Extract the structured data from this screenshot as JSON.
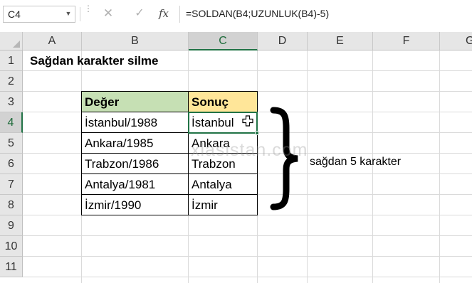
{
  "formula_bar": {
    "name_box": "C4",
    "cancel_icon": "✕",
    "enter_icon": "✓",
    "fx_label": "fx",
    "formula": "=SOLDAN(B4;UZUNLUK(B4)-5)"
  },
  "columns": [
    "A",
    "B",
    "C",
    "D",
    "E",
    "F",
    "G"
  ],
  "rows": [
    "1",
    "2",
    "3",
    "4",
    "5",
    "6",
    "7",
    "8",
    "9",
    "10",
    "11"
  ],
  "sheet": {
    "title": "Sağdan karakter silme",
    "header_deger": "Değer",
    "header_sonuc": "Sonuç",
    "values": [
      "İstanbul/1988",
      "Ankara/1985",
      "Trabzon/1986",
      "Antalya/1981",
      "İzmir/1990"
    ],
    "results": [
      "İstanbul",
      "Ankara",
      "Trabzon",
      "Antalya",
      "İzmir"
    ],
    "note": "sağdan 5 karakter",
    "watermark": "xlasistan.com"
  },
  "colors": {
    "header_deger_bg": "#c6e0b4",
    "header_sonuc_bg": "#ffe699",
    "selection": "#217346"
  },
  "icons": {
    "cursor": "cell-select-cursor-icon",
    "dropdown": "chevron-down-icon"
  }
}
